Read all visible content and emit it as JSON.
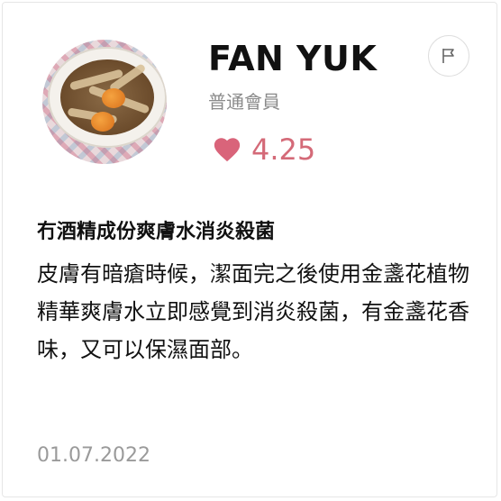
{
  "reviewer": {
    "name": "FAN YUK",
    "level": "普通會員",
    "rating": "4.25",
    "avatar_icon": "food-bowl-avatar"
  },
  "review": {
    "title": "冇酒精成份爽膚水消炎殺菌",
    "body": "皮膚有暗瘡時候，潔面完之後使用金盞花植物精華爽膚水立即感覺到消炎殺菌，有金盞花香味，又可以保濕面部。",
    "date": "01.07.2022"
  },
  "colors": {
    "heart": "#d9647a",
    "rating_text": "#d46a78",
    "muted_text": "#8a8a8a"
  },
  "icons": {
    "rating": "heart-icon",
    "report": "flag-icon"
  }
}
